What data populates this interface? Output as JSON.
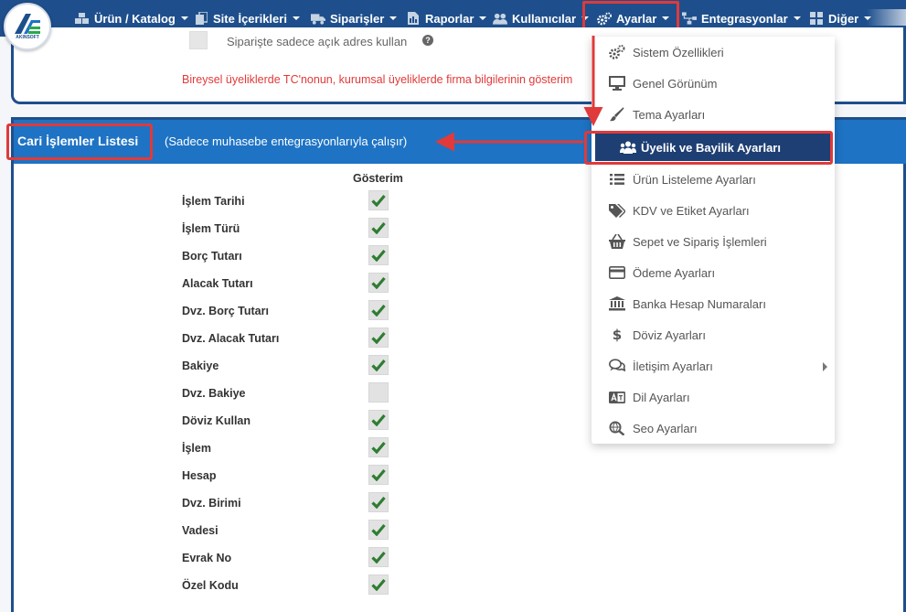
{
  "nav": {
    "logo_text": "AKINSOFT",
    "items": [
      {
        "label": "Ürün / Katalog",
        "icon": "cubes-icon"
      },
      {
        "label": "Site İçerikleri",
        "icon": "copy-icon"
      },
      {
        "label": "Siparişler",
        "icon": "truck-icon"
      },
      {
        "label": "Raporlar",
        "icon": "report-icon"
      },
      {
        "label": "Kullanıcılar",
        "icon": "users-icon"
      },
      {
        "label": "Ayarlar",
        "icon": "gears-icon"
      },
      {
        "label": "Entegrasyonlar",
        "icon": "sitemap-icon"
      },
      {
        "label": "Diğer",
        "icon": "grid-icon"
      }
    ]
  },
  "top_panel": {
    "address_label": "Siparişte sadece açık adres kullan",
    "help_icon": "?",
    "note": "Bireysel üyeliklerde TC'nonun, kurumsal üyeliklerde firma bilgilerinin gösterim"
  },
  "section": {
    "title": "Cari İşlemler Listesi",
    "subtitle": "(Sadece muhasebe entegrasyonlarıyla çalışır)",
    "column_header": "Gösterim",
    "rows": [
      {
        "label": "İşlem Tarihi",
        "checked": true
      },
      {
        "label": "İşlem Türü",
        "checked": true
      },
      {
        "label": "Borç Tutarı",
        "checked": true
      },
      {
        "label": "Alacak Tutarı",
        "checked": true
      },
      {
        "label": "Dvz. Borç Tutarı",
        "checked": true
      },
      {
        "label": "Dvz. Alacak Tutarı",
        "checked": true
      },
      {
        "label": "Bakiye",
        "checked": true
      },
      {
        "label": "Dvz. Bakiye",
        "checked": false
      },
      {
        "label": "Döviz Kullan",
        "checked": true
      },
      {
        "label": "İşlem",
        "checked": true
      },
      {
        "label": "Hesap",
        "checked": true
      },
      {
        "label": "Dvz. Birimi",
        "checked": true
      },
      {
        "label": "Vadesi",
        "checked": true
      },
      {
        "label": "Evrak No",
        "checked": true
      },
      {
        "label": "Özel Kodu",
        "checked": true
      }
    ]
  },
  "dropdown": {
    "items": [
      {
        "label": "Sistem Özellikleri",
        "icon": "cogs-icon"
      },
      {
        "label": "Genel Görünüm",
        "icon": "desktop-icon"
      },
      {
        "label": "Tema Ayarları",
        "icon": "brush-icon"
      },
      {
        "label": "Üyelik ve Bayilik Ayarları",
        "icon": "users-icon",
        "active": true
      },
      {
        "label": "Ürün Listeleme Ayarları",
        "icon": "list-icon"
      },
      {
        "label": "KDV ve Etiket Ayarları",
        "icon": "tags-icon"
      },
      {
        "label": "Sepet ve Sipariş İşlemleri",
        "icon": "basket-icon"
      },
      {
        "label": "Ödeme Ayarları",
        "icon": "credit-card-icon"
      },
      {
        "label": "Banka Hesap Numaraları",
        "icon": "bank-icon"
      },
      {
        "label": "Döviz Ayarları",
        "icon": "dollar-icon"
      },
      {
        "label": "İletişim Ayarları",
        "icon": "comments-icon",
        "has_submenu": true
      },
      {
        "label": "Dil Ayarları",
        "icon": "language-icon"
      },
      {
        "label": "Seo Ayarları",
        "icon": "globe-search-icon"
      }
    ]
  },
  "colors": {
    "nav_bg": "#1e4f8c",
    "header_bg": "#1e73c4",
    "highlight": "#e03a3a",
    "active_item": "#1e3f73",
    "check": "#2e7d32"
  }
}
